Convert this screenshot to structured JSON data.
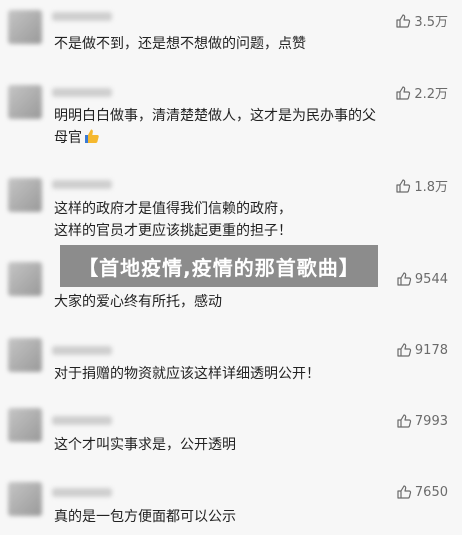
{
  "comments": [
    {
      "likes": "3.5万",
      "lines": [
        "不是做不到，还是想不想做的问题，点赞"
      ]
    },
    {
      "likes": "2.2万",
      "lines": [
        "明明白白做事，清清楚楚做人，这才是为民办事的父",
        "母官"
      ],
      "emoji": "thumbs-up-emoji"
    },
    {
      "likes": "1.8万",
      "lines": [
        "这样的政府才是值得我们信赖的政府，",
        "这样的官员才更应该挑起更重的担子！"
      ]
    },
    {
      "likes": "9544",
      "lines": [
        "大家的爱心终有所托，感动"
      ]
    },
    {
      "likes": "9178",
      "lines": [
        "对于捐赠的物资就应该这样详细透明公开！"
      ]
    },
    {
      "likes": "7993",
      "lines": [
        "这个才叫实事求是，公开透明"
      ]
    },
    {
      "likes": "7650",
      "lines": [
        "真的是一包方便面都可以公示"
      ]
    }
  ],
  "banner": {
    "title": "【首地疫情,疫情的那首歌曲】"
  },
  "icons": {
    "like": "thumbs-up-outline-icon"
  },
  "colors": {
    "background": "#f7f7f7",
    "text": "#222222",
    "likes": "#6b6b6b",
    "banner": "#6e6e6e"
  }
}
